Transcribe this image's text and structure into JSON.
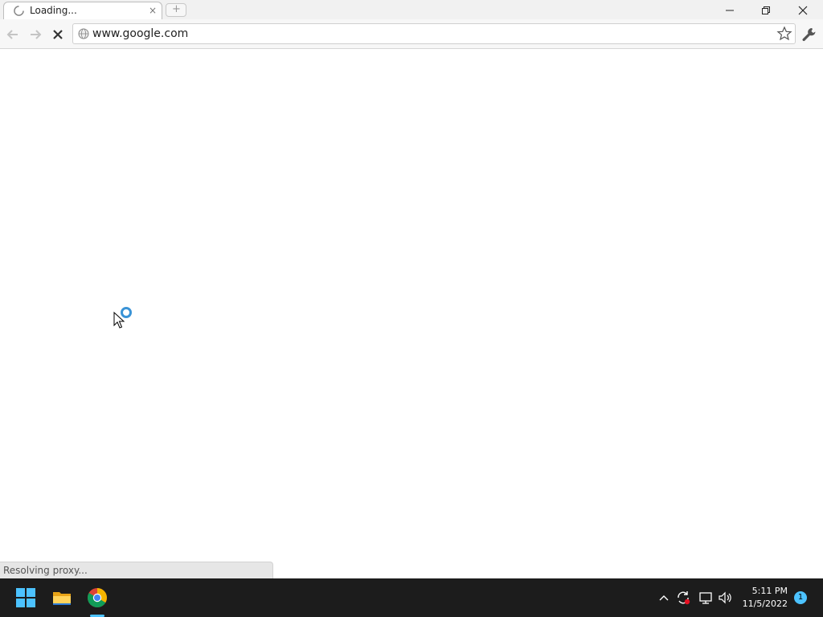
{
  "browser": {
    "tab": {
      "title": "Loading...",
      "close": "×"
    },
    "new_tab": "+",
    "address": {
      "url": "www.google.com"
    },
    "icons": [
      "back-icon",
      "forward-icon",
      "stop-icon",
      "globe-icon",
      "star-icon",
      "wrench-icon"
    ]
  },
  "window_controls": {
    "minimize": "—",
    "restore": "❐",
    "close": "✕"
  },
  "status": {
    "text": "Resolving proxy..."
  },
  "taskbar": {
    "apps": [
      "windows-start-icon",
      "file-explorer-icon",
      "chrome-icon"
    ],
    "tray": [
      "chevron-up-icon",
      "sync-icon",
      "network-icon",
      "volume-icon"
    ],
    "clock": {
      "time": "5:11 PM",
      "date": "11/5/2022"
    },
    "notification_count": "1"
  },
  "colors": {
    "accent": "#4cc2ff",
    "taskbar": "#1c1c1c",
    "spinner": "#3a93d6"
  }
}
